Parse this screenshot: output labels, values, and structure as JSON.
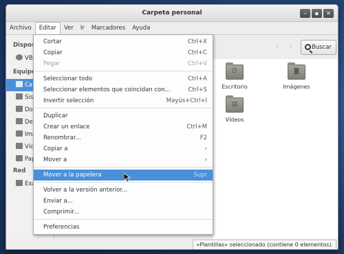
{
  "window": {
    "title": "Carpeta personal"
  },
  "menubar": [
    "Archivo",
    "Editar",
    "Ver",
    "Ir",
    "Marcadores",
    "Ayuda"
  ],
  "sidebar": {
    "devices_header": "Dispos",
    "devices": [
      {
        "label": "VBO",
        "icon": "disc-icon"
      }
    ],
    "places_header": "Equipo",
    "places": [
      {
        "label": "Carp",
        "icon": "home-icon",
        "selected": true
      },
      {
        "label": "Sist",
        "icon": "harddisk-icon",
        "selected": false
      },
      {
        "label": "Doc",
        "icon": "folder-icon",
        "selected": false
      },
      {
        "label": "Des",
        "icon": "folder-icon",
        "selected": false
      },
      {
        "label": "Imá",
        "icon": "folder-icon",
        "selected": false
      },
      {
        "label": "Víd",
        "icon": "folder-icon",
        "selected": false
      },
      {
        "label": "Pap",
        "icon": "trash-icon",
        "selected": false
      }
    ],
    "network_header": "Red",
    "network": [
      {
        "label": "Exa",
        "icon": "network-icon"
      }
    ]
  },
  "toolbar": {
    "search_label": "Buscar"
  },
  "files": [
    {
      "label": "Escritorio",
      "glyph": "D"
    },
    {
      "label": "Imágenes",
      "glyph": "◙"
    },
    {
      "label": "Vídeos",
      "glyph": "▤"
    }
  ],
  "edit_menu": {
    "items": [
      {
        "label": "Cortar",
        "accel": "Ctrl+X",
        "disabled": false
      },
      {
        "label": "Copiar",
        "accel": "Ctrl+C",
        "disabled": false
      },
      {
        "label": "Pegar",
        "accel": "Ctrl+V",
        "disabled": true
      },
      {
        "label": "Seleccionar todo",
        "accel": "Ctrl+A",
        "disabled": false
      },
      {
        "label": "Seleccionar elementos que coincidan con...",
        "accel": "Ctrl+S",
        "disabled": false
      },
      {
        "label": "Invertir selección",
        "accel": "Mayús+Ctrl+I",
        "disabled": false
      },
      {
        "label": "Duplicar",
        "accel": "",
        "disabled": false
      },
      {
        "label": "Crear un enlace",
        "accel": "Ctrl+M",
        "disabled": false
      },
      {
        "label": "Renombrar...",
        "accel": "F2",
        "disabled": false
      },
      {
        "label": "Copiar a",
        "accel": "›",
        "disabled": false
      },
      {
        "label": "Mover a",
        "accel": "›",
        "disabled": false
      },
      {
        "label": "Mover a la papelera",
        "accel": "Supr",
        "disabled": false,
        "highlighted": true
      },
      {
        "label": "Volver a la versión anterior...",
        "accel": "",
        "disabled": false
      },
      {
        "label": "Enviar a...",
        "accel": "",
        "disabled": false
      },
      {
        "label": "Comprimir...",
        "accel": "",
        "disabled": false
      },
      {
        "label": "Preferencias",
        "accel": "",
        "disabled": false
      }
    ]
  },
  "status": {
    "text": "«Plantillas» seleccionado (contiene 0 elementos)."
  },
  "colors": {
    "selection": "#4a90d9",
    "window_bg": "#ededed"
  }
}
